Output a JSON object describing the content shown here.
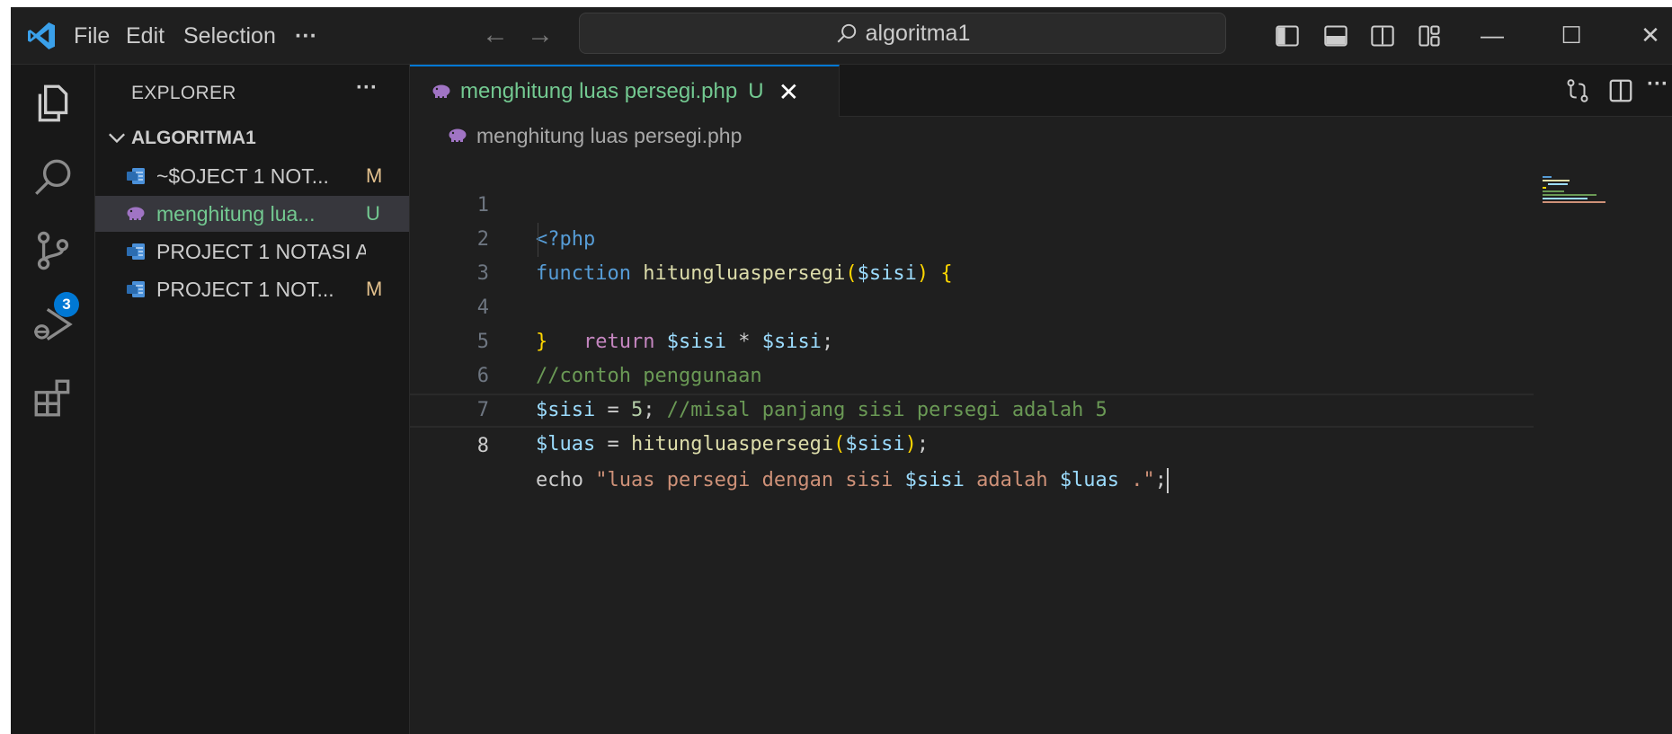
{
  "titlebar": {
    "menu": [
      "File",
      "Edit",
      "Selection"
    ],
    "more": "···",
    "back_arrow": "←",
    "forward_arrow": "→",
    "search_text": "algoritma1",
    "window_controls": {
      "minimize": "—",
      "maximize": "☐",
      "close": "✕"
    }
  },
  "activitybar": {
    "items": [
      "explorer-icon",
      "search-icon",
      "source-control-icon",
      "run-debug-icon",
      "extensions-icon"
    ],
    "source_control_badge": "3"
  },
  "sidebar": {
    "title": "EXPLORER",
    "more": "···",
    "folder": "ALGORITMA1",
    "files": [
      {
        "name": "~$OJECT 1 NOT...",
        "status": "M",
        "icon": "word-doc-icon",
        "selected": false,
        "untracked": false
      },
      {
        "name": "menghitung lua...",
        "status": "U",
        "icon": "php-elephant-icon",
        "selected": true,
        "untracked": true
      },
      {
        "name": "PROJECT 1 NOTASI A...",
        "status": "",
        "icon": "word-doc-icon",
        "selected": false,
        "untracked": false
      },
      {
        "name": "PROJECT 1 NOT...",
        "status": "M",
        "icon": "word-doc-icon",
        "selected": false,
        "untracked": false
      }
    ]
  },
  "editor": {
    "tab": {
      "label": "menghitung luas persegi.php",
      "status": "U",
      "close": "✕"
    },
    "breadcrumb": "menghitung luas persegi.php",
    "current_line": 8,
    "line_numbers": [
      "1",
      "2",
      "3",
      "4",
      "5",
      "6",
      "7",
      "8"
    ],
    "code": {
      "l1": {
        "open_tag": "<?php"
      },
      "l2": {
        "kw": "function",
        "fn": "hitungluaspersegi",
        "open_paren": "(",
        "param": "$sisi",
        "close_paren": ")",
        "brace": "{"
      },
      "l3": {
        "kw": "return",
        "var1": "$sisi",
        "op": " * ",
        "var2": "$sisi",
        "end": ";"
      },
      "l4": {
        "brace": "}"
      },
      "l5": {
        "comment": "//contoh penggunaan"
      },
      "l6": {
        "var": "$sisi",
        "op": " = ",
        "num": "5",
        "semi": "; ",
        "comment": "//misal panjang sisi persegi adalah 5"
      },
      "l7": {
        "var": "$luas",
        "op": " = ",
        "fn": "hitungluaspersegi",
        "open_paren": "(",
        "arg": "$sisi",
        "close_paren": ")",
        "semi": ";"
      },
      "l8": {
        "kw": "echo",
        "s1": "\"luas persegi dengan sisi ",
        "v1": "$sisi",
        "s2": " adalah ",
        "v2": "$luas",
        "s3": " .\"",
        "semi": ";"
      }
    }
  },
  "colors": {
    "accent": "#0078d4",
    "modified": "#e2c08d",
    "untracked": "#73c991",
    "php_purple": "#a074c4",
    "word_blue": "#4a90d9"
  }
}
